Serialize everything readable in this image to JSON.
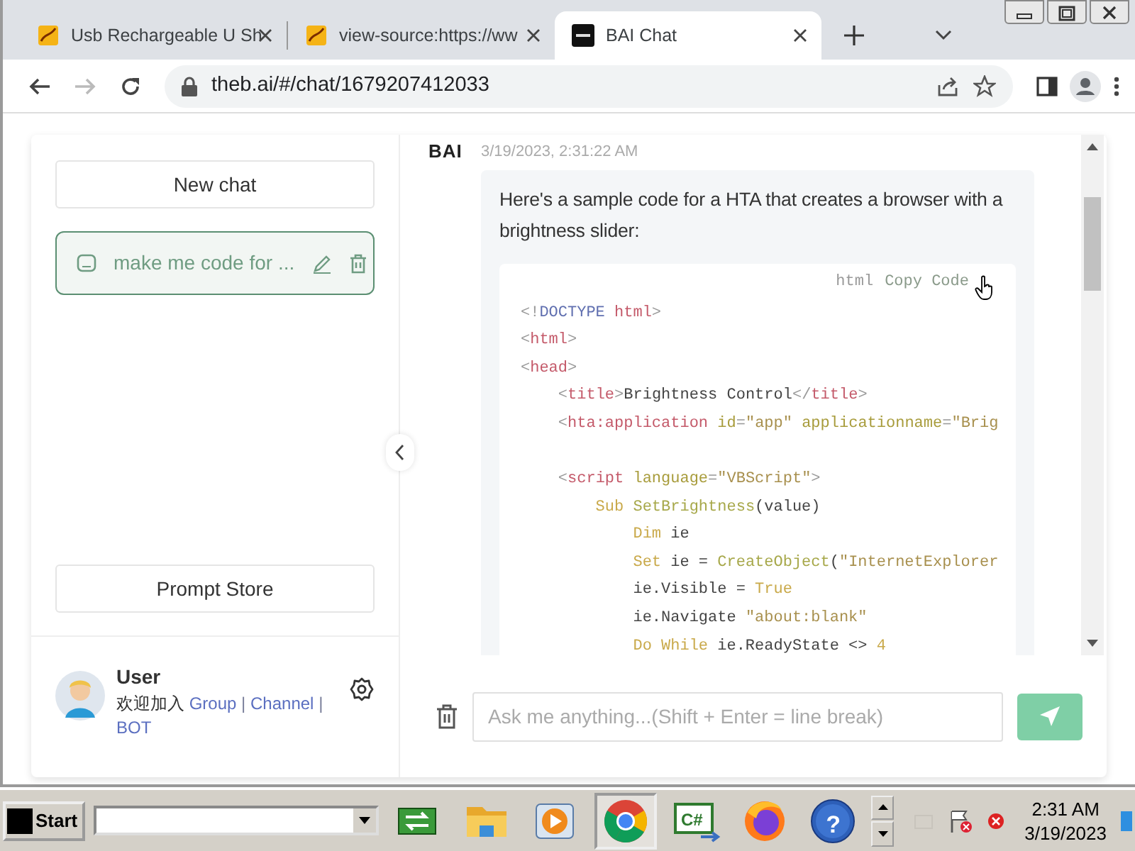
{
  "browser": {
    "tabs": [
      {
        "title": "Usb Rechargeable U Sh",
        "kind": "page",
        "selected": false
      },
      {
        "title": "view-source:https://ww",
        "kind": "page",
        "selected": false
      },
      {
        "title": "BAI Chat",
        "kind": "chat",
        "selected": true
      }
    ],
    "nav": [
      {
        "kind": "back",
        "disabled": false
      },
      {
        "kind": "forward",
        "disabled": true
      },
      {
        "kind": "reload",
        "disabled": false
      }
    ],
    "address": "theb.ai/#/chat/1679207412033"
  },
  "sidebar": {
    "new_chat": "New chat",
    "chats": [
      {
        "title": "make me code for ...",
        "selected": true
      }
    ],
    "prompt_store": "Prompt Store",
    "user": {
      "name": "User",
      "intro": "欢迎加入",
      "links": [
        {
          "kind": "link",
          "text": "Group"
        },
        {
          "kind": "separator",
          "text": "|"
        },
        {
          "kind": "link",
          "text": "Channel"
        },
        {
          "kind": "separator",
          "text": "|"
        },
        {
          "kind": "link",
          "text": "BOT"
        }
      ]
    }
  },
  "message": {
    "sender": "BAI",
    "time": "3/19/2023, 2:31:22 AM",
    "text": "Here's a sample code for a HTA that creates a browser with a brightness slider:",
    "code": {
      "language": "html",
      "copy": "Copy Code",
      "lines": [
        {
          "kind": "code",
          "tokens": [
            {
              "kind": "punct",
              "text": "<!"
            },
            {
              "kind": "doctype",
              "text": "DOCTYPE "
            },
            {
              "kind": "tag",
              "text": "html"
            },
            {
              "kind": "punct",
              "text": ">"
            }
          ]
        },
        {
          "kind": "code",
          "tokens": [
            {
              "kind": "punct",
              "text": "<"
            },
            {
              "kind": "tag",
              "text": "html"
            },
            {
              "kind": "punct",
              "text": ">"
            }
          ]
        },
        {
          "kind": "code",
          "tokens": [
            {
              "kind": "punct",
              "text": "<"
            },
            {
              "kind": "tag",
              "text": "head"
            },
            {
              "kind": "punct",
              "text": ">"
            }
          ]
        },
        {
          "kind": "code",
          "tokens": [
            {
              "kind": "punct",
              "text": "    <"
            },
            {
              "kind": "tag",
              "text": "title"
            },
            {
              "kind": "punct",
              "text": ">"
            },
            {
              "kind": "plain",
              "text": "Brightness Control"
            },
            {
              "kind": "punct",
              "text": "</"
            },
            {
              "kind": "tag",
              "text": "title"
            },
            {
              "kind": "punct",
              "text": ">"
            }
          ]
        },
        {
          "kind": "code",
          "tokens": [
            {
              "kind": "punct",
              "text": "    <"
            },
            {
              "kind": "tag",
              "text": "hta:application"
            },
            {
              "kind": "attr",
              "text": " id"
            },
            {
              "kind": "punct",
              "text": "="
            },
            {
              "kind": "string",
              "text": "\"app\""
            },
            {
              "kind": "attr",
              "text": " applicationname"
            },
            {
              "kind": "punct",
              "text": "="
            },
            {
              "kind": "string",
              "text": "\"Brig"
            }
          ]
        },
        {
          "kind": "blank"
        },
        {
          "kind": "code",
          "tokens": [
            {
              "kind": "punct",
              "text": "    <"
            },
            {
              "kind": "tag",
              "text": "script"
            },
            {
              "kind": "attr",
              "text": " language"
            },
            {
              "kind": "punct",
              "text": "="
            },
            {
              "kind": "string",
              "text": "\"VBScript\""
            },
            {
              "kind": "punct",
              "text": ">"
            }
          ]
        },
        {
          "kind": "code",
          "tokens": [
            {
              "kind": "keyword",
              "text": "        Sub"
            },
            {
              "kind": "func",
              "text": " SetBrightness"
            },
            {
              "kind": "plain",
              "text": "(value)"
            }
          ]
        },
        {
          "kind": "code",
          "tokens": [
            {
              "kind": "keyword",
              "text": "            Dim"
            },
            {
              "kind": "plain",
              "text": " ie"
            }
          ]
        },
        {
          "kind": "code",
          "tokens": [
            {
              "kind": "keyword",
              "text": "            Set"
            },
            {
              "kind": "plain",
              "text": " ie = "
            },
            {
              "kind": "func",
              "text": "CreateObject"
            },
            {
              "kind": "plain",
              "text": "("
            },
            {
              "kind": "string",
              "text": "\"InternetExplorer"
            }
          ]
        },
        {
          "kind": "code",
          "tokens": [
            {
              "kind": "plain",
              "text": "            ie.Visible = "
            },
            {
              "kind": "keyword",
              "text": "True"
            }
          ]
        },
        {
          "kind": "code",
          "tokens": [
            {
              "kind": "plain",
              "text": "            ie.Navigate "
            },
            {
              "kind": "string",
              "text": "\"about:blank\""
            }
          ]
        },
        {
          "kind": "code",
          "tokens": [
            {
              "kind": "keyword",
              "text": "            Do"
            },
            {
              "kind": "keyword",
              "text": " While"
            },
            {
              "kind": "plain",
              "text": " ie.ReadyState <> "
            },
            {
              "kind": "number",
              "text": "4"
            }
          ]
        }
      ]
    }
  },
  "composer": {
    "placeholder": "Ask me anything...(Shift + Enter = line break)"
  },
  "taskbar": {
    "start": "Start",
    "apps": [
      {
        "kind": "sync",
        "selected": false
      },
      {
        "kind": "folder",
        "selected": false
      },
      {
        "kind": "media",
        "selected": false
      },
      {
        "kind": "chrome",
        "selected": true
      },
      {
        "kind": "csharp",
        "label": "C#",
        "selected": false
      },
      {
        "kind": "firefox",
        "selected": false
      },
      {
        "kind": "help",
        "label": "?",
        "selected": false
      }
    ],
    "time": "2:31 AM",
    "date": "3/19/2023"
  }
}
